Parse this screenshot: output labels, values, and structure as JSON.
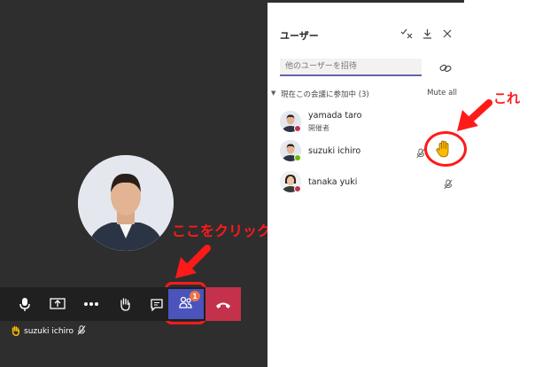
{
  "toolbar": {
    "buttons": [
      "microphone-icon",
      "share-screen-icon",
      "more-options-icon",
      "raise-hand-icon",
      "chat-icon",
      "participants-icon",
      "hang-up-icon"
    ],
    "participants_badge": "1"
  },
  "self_label": {
    "name": "suzuki ichiro",
    "hand_icon": "hand-raised-icon",
    "mic_icon": "mic-off-icon"
  },
  "callouts": {
    "click_here": "ここをクリック",
    "this": "これ",
    "color": "#ff1a1a"
  },
  "panel": {
    "title": "ユーザー",
    "header_icons": [
      "dismiss-all-icon",
      "download-icon",
      "close-icon"
    ],
    "invite_placeholder": "他のユーザーを招待",
    "section_title": "現在この会議に参加中 (3)",
    "mute_all": "Mute all",
    "participants": [
      {
        "name": "yamada taro",
        "role": "開催者",
        "status_color": "#c4314b"
      },
      {
        "name": "suzuki ichiro",
        "role": "",
        "status_color": "#6bb700",
        "hand_raised": true,
        "mic": "mic-off-icon"
      },
      {
        "name": "tanaka yuki",
        "role": "",
        "status_color": "#c4314b",
        "mic": "mic-off-icon"
      }
    ]
  },
  "colors": {
    "stage_bg": "#2e2e2e",
    "toolbar_bg": "#202020",
    "accent": "#4b53bc",
    "hangup": "#c4314b",
    "hand": "#ffb900"
  }
}
